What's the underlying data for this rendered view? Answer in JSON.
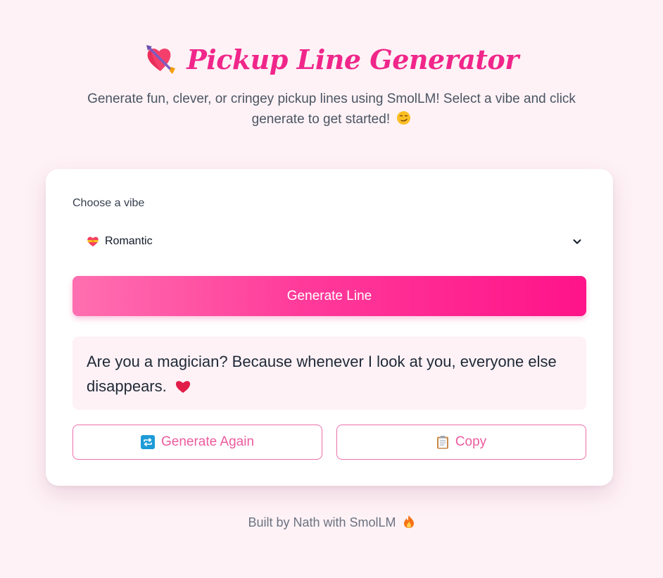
{
  "header": {
    "title": "Pickup Line Generator",
    "subtitle": "Generate fun, clever, or cringey pickup lines using SmolLM! Select a vibe and click generate to get started!",
    "title_icon": "heart-with-arrow-icon",
    "subtitle_emoji": "smirking-face-icon"
  },
  "form": {
    "vibe_label": "Choose a vibe",
    "selected_vibe": "Romantic",
    "selected_vibe_icon": "heart-with-ribbon-icon",
    "generate_label": "Generate Line"
  },
  "result": {
    "line": "Are you a magician? Because whenever I look at you, everyone else disappears.",
    "emoji": "red-heart-icon"
  },
  "actions": {
    "again_label": "Generate Again",
    "again_icon": "repeat-icon",
    "copy_label": "Copy",
    "copy_icon": "clipboard-icon"
  },
  "footer": {
    "text": "Built by Nath with SmolLM",
    "icon": "fire-icon"
  },
  "colors": {
    "background": "#fef2f6",
    "accent": "#f0268a",
    "button_gradient_start": "#ff6fb0",
    "button_gradient_end": "#ff1389",
    "outline": "#ec6fa9"
  }
}
